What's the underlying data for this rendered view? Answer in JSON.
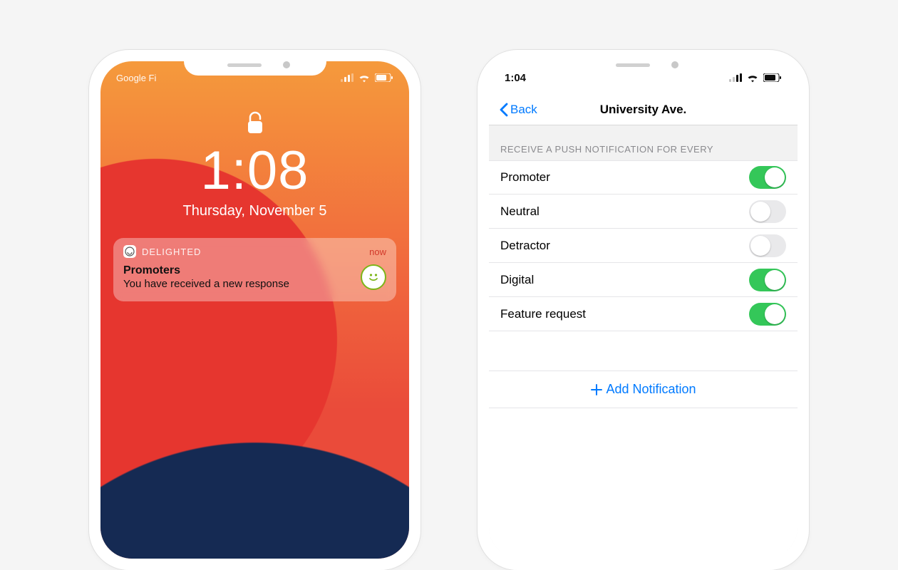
{
  "lockscreen": {
    "carrier": "Google Fi",
    "time": "1:08",
    "date": "Thursday, November 5",
    "notification": {
      "app_name": "DELIGHTED",
      "when": "now",
      "title": "Promoters",
      "message": "You have received a new response"
    }
  },
  "settings": {
    "status_time": "1:04",
    "back_label": "Back",
    "title": "University Ave.",
    "section_header": "RECEIVE A PUSH NOTIFICATION FOR EVERY",
    "rows": [
      {
        "label": "Promoter",
        "on": true
      },
      {
        "label": "Neutral",
        "on": false
      },
      {
        "label": "Detractor",
        "on": false
      },
      {
        "label": "Digital",
        "on": true
      },
      {
        "label": "Feature request",
        "on": true
      }
    ],
    "add_label": "Add Notification"
  }
}
